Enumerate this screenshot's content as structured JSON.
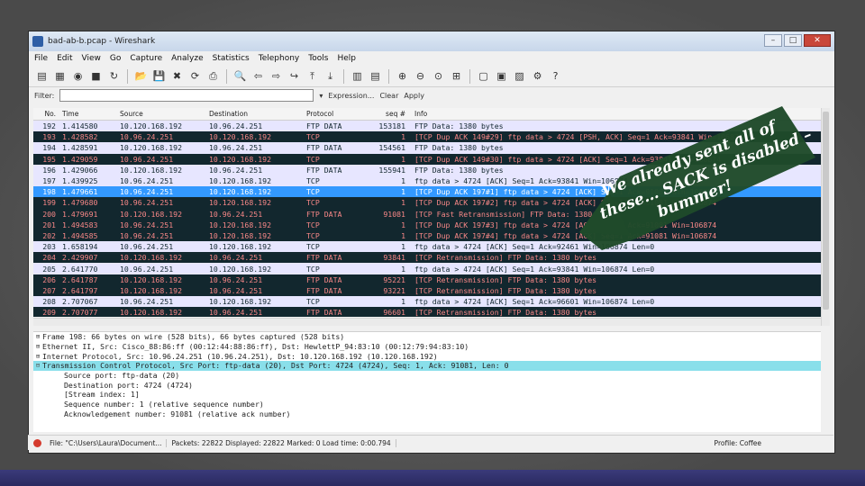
{
  "window": {
    "title": "bad-ab-b.pcap - Wireshark",
    "btn_min": "–",
    "btn_max": "□",
    "btn_close": "✕"
  },
  "menu": [
    "File",
    "Edit",
    "View",
    "Go",
    "Capture",
    "Analyze",
    "Statistics",
    "Telephony",
    "Tools",
    "Help"
  ],
  "filter": {
    "label": "Filter:",
    "value": "",
    "expression": "Expression...",
    "clear": "Clear",
    "apply": "Apply"
  },
  "columns": {
    "no": "No.",
    "time": "Time",
    "source": "Source",
    "destination": "Destination",
    "protocol": "Protocol",
    "seq": "seq #",
    "info": "Info"
  },
  "packets": [
    {
      "no": "192",
      "time": "1.414580",
      "src": "10.120.168.192",
      "dst": "10.96.24.251",
      "proto": "FTP DATA",
      "seq": "153181",
      "info": "FTP Data: 1380 bytes",
      "style": "r-norm"
    },
    {
      "no": "193",
      "time": "1.428582",
      "src": "10.96.24.251",
      "dst": "10.120.168.192",
      "proto": "TCP",
      "seq": "1",
      "info": "[TCP Dup ACK 149#29] ftp data > 4724 [PSH, ACK] Seq=1 Ack=93841 Win=106874",
      "style": "r-bad"
    },
    {
      "no": "194",
      "time": "1.428591",
      "src": "10.120.168.192",
      "dst": "10.96.24.251",
      "proto": "FTP DATA",
      "seq": "154561",
      "info": "FTP Data: 1380 bytes",
      "style": "r-norm"
    },
    {
      "no": "195",
      "time": "1.429059",
      "src": "10.96.24.251",
      "dst": "10.120.168.192",
      "proto": "TCP",
      "seq": "1",
      "info": "[TCP Dup ACK 149#30] ftp data > 4724 [ACK] Seq=1 Ack=93841 Win=106874",
      "style": "r-bad"
    },
    {
      "no": "196",
      "time": "1.429066",
      "src": "10.120.168.192",
      "dst": "10.96.24.251",
      "proto": "FTP DATA",
      "seq": "155941",
      "info": "FTP Data: 1380 bytes",
      "style": "r-norm"
    },
    {
      "no": "197",
      "time": "1.439925",
      "src": "10.96.24.251",
      "dst": "10.120.168.192",
      "proto": "TCP",
      "seq": "1",
      "info": "ftp data > 4724 [ACK] Seq=1 Ack=93841 Win=106874",
      "style": "r-norm"
    },
    {
      "no": "198",
      "time": "1.479661",
      "src": "10.96.24.251",
      "dst": "10.120.168.192",
      "proto": "TCP",
      "seq": "1",
      "info": "[TCP Dup ACK 197#1] ftp data > 4724 [ACK] Seq=1 Ack=91081 Win=106874",
      "style": "r-sel"
    },
    {
      "no": "199",
      "time": "1.479680",
      "src": "10.96.24.251",
      "dst": "10.120.168.192",
      "proto": "TCP",
      "seq": "1",
      "info": "[TCP Dup ACK 197#2] ftp data > 4724 [ACK] Seq=1 Ack=91081 Win=106874",
      "style": "r-bad"
    },
    {
      "no": "200",
      "time": "1.479691",
      "src": "10.120.168.192",
      "dst": "10.96.24.251",
      "proto": "FTP DATA",
      "seq": "91081",
      "info": "[TCP Fast Retransmission] FTP Data: 1380 bytes",
      "style": "r-bad"
    },
    {
      "no": "201",
      "time": "1.494583",
      "src": "10.96.24.251",
      "dst": "10.120.168.192",
      "proto": "TCP",
      "seq": "1",
      "info": "[TCP Dup ACK 197#3] ftp data > 4724 [ACK] Seq=1 Ack=91081 Win=106874",
      "style": "r-bad"
    },
    {
      "no": "202",
      "time": "1.494585",
      "src": "10.96.24.251",
      "dst": "10.120.168.192",
      "proto": "TCP",
      "seq": "1",
      "info": "[TCP Dup ACK 197#4] ftp data > 4724 [ACK] Seq=1 Ack=91081 Win=106874",
      "style": "r-bad"
    },
    {
      "no": "203",
      "time": "1.658194",
      "src": "10.96.24.251",
      "dst": "10.120.168.192",
      "proto": "TCP",
      "seq": "1",
      "info": "ftp data > 4724 [ACK] Seq=1 Ack=92461 Win=106874 Len=0",
      "style": "r-norm"
    },
    {
      "no": "204",
      "time": "2.429907",
      "src": "10.120.168.192",
      "dst": "10.96.24.251",
      "proto": "FTP DATA",
      "seq": "93841",
      "info": "[TCP Retransmission] FTP Data: 1380 bytes",
      "style": "r-bad"
    },
    {
      "no": "205",
      "time": "2.641770",
      "src": "10.96.24.251",
      "dst": "10.120.168.192",
      "proto": "TCP",
      "seq": "1",
      "info": "ftp data > 4724 [ACK] Seq=1 Ack=93841 Win=106874 Len=0",
      "style": "r-norm"
    },
    {
      "no": "206",
      "time": "2.641787",
      "src": "10.120.168.192",
      "dst": "10.96.24.251",
      "proto": "FTP DATA",
      "seq": "95221",
      "info": "[TCP Retransmission] FTP Data: 1380 bytes",
      "style": "r-bad"
    },
    {
      "no": "207",
      "time": "2.641797",
      "src": "10.120.168.192",
      "dst": "10.96.24.251",
      "proto": "FTP DATA",
      "seq": "93221",
      "info": "[TCP Retransmission] FTP Data: 1380 bytes",
      "style": "r-bad"
    },
    {
      "no": "208",
      "time": "2.707067",
      "src": "10.96.24.251",
      "dst": "10.120.168.192",
      "proto": "TCP",
      "seq": "1",
      "info": "ftp data > 4724 [ACK] Seq=1 Ack=96601 Win=106874 Len=0",
      "style": "r-norm"
    },
    {
      "no": "209",
      "time": "2.707077",
      "src": "10.120.168.192",
      "dst": "10.96.24.251",
      "proto": "FTP DATA",
      "seq": "96601",
      "info": "[TCP Retransmission] FTP Data: 1380 bytes",
      "style": "r-bad"
    }
  ],
  "details": [
    {
      "exp": "⊞",
      "text": "Frame 198: 66 bytes on wire (528 bits), 66 bytes captured (528 bits)",
      "sel": false,
      "indent": 0
    },
    {
      "exp": "⊞",
      "text": "Ethernet II, Src: Cisco_88:86:ff (00:12:44:88:86:ff), Dst: HewlettP_94:83:10 (00:12:79:94:83:10)",
      "sel": false,
      "indent": 0
    },
    {
      "exp": "⊞",
      "text": "Internet Protocol, Src: 10.96.24.251 (10.96.24.251), Dst: 10.120.168.192 (10.120.168.192)",
      "sel": false,
      "indent": 0
    },
    {
      "exp": "⊟",
      "text": "Transmission Control Protocol, Src Port: ftp-data (20), Dst Port: 4724 (4724), Seq: 1, Ack: 91081, Len: 0",
      "sel": true,
      "indent": 0
    },
    {
      "exp": "",
      "text": "Source port: ftp-data (20)",
      "sel": false,
      "indent": 1
    },
    {
      "exp": "",
      "text": "Destination port: 4724 (4724)",
      "sel": false,
      "indent": 1
    },
    {
      "exp": "",
      "text": "[Stream index: 1]",
      "sel": false,
      "indent": 1
    },
    {
      "exp": "",
      "text": "Sequence number: 1    (relative sequence number)",
      "sel": false,
      "indent": 1
    },
    {
      "exp": "",
      "text": "Acknowledgement number: 91081    (relative ack number)",
      "sel": false,
      "indent": 1
    }
  ],
  "status": {
    "file": "File: \"C:\\Users\\Laura\\Document...",
    "packets": "Packets: 22822 Displayed: 22822 Marked: 0 Load time: 0:00.794",
    "profile": "Profile: Coffee"
  },
  "annotation": {
    "line1": "We already sent all of",
    "line2": "these… SACK is disabled –",
    "line3": "bummer!"
  },
  "colors": {
    "normal_row": "#e7e6ff",
    "bad_row": "#12272e",
    "bad_text": "#f78787",
    "selected_row": "#3399ff",
    "arrow": "#1f4a2a"
  }
}
